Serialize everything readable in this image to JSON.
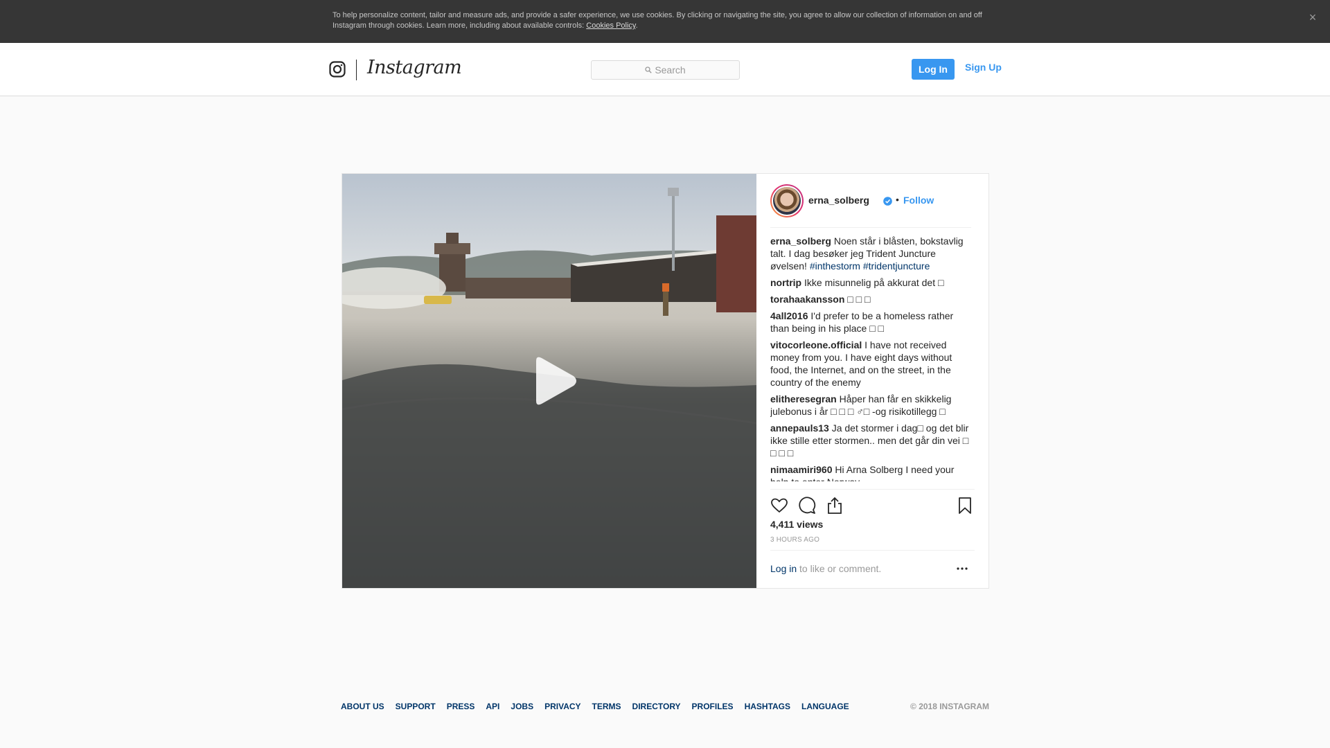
{
  "cookie_banner": {
    "text": "To help personalize content, tailor and measure ads, and provide a safer experience, we use cookies. By clicking or navigating the site, you agree to allow our collection of information on and off Instagram through cookies. Learn more, including about available controls: ",
    "link": "Cookies Policy",
    "trailing": ".",
    "close": "×"
  },
  "navbar": {
    "logo_text": "Instagram",
    "search_placeholder": "Search",
    "login_label": "Log In",
    "signup_label": "Sign Up"
  },
  "post": {
    "username": "erna_solberg",
    "separator": "•",
    "follow_label": "Follow",
    "caption": {
      "user": "erna_solberg",
      "text": " Noen står i blåsten, bokstavlig talt. I dag besøker jeg Trident Juncture øvelsen! ",
      "hashtags": [
        "#inthestorm",
        "#tridentjuncture"
      ]
    },
    "comments": [
      {
        "user": "nortrip",
        "text": " Ikke misunnelig på akkurat det □"
      },
      {
        "user": "torahaakansson",
        "text": " □ □ □"
      },
      {
        "user": "4all2016",
        "text": " I'd prefer to be a homeless rather than being in his place □ □"
      },
      {
        "user": "vitocorleone.official",
        "text": " I have not received money from you. I have eight days without food, the Internet, and on the street, in the country of the enemy"
      },
      {
        "user": "elitheresegran",
        "text": " Håper han får en skikkelig julebonus i år □ □ □ ♂□  -og risikotillegg □"
      },
      {
        "user": "annepauls13",
        "text": " Ja det stormer i dag□ og det blir ikke stille etter stormen.. men det går din vei □ □ □ □"
      },
      {
        "user": "nimaamiri960",
        "text": " Hi Arna Solberg I need your help to enter Norway"
      }
    ],
    "views": "4,411 views",
    "timestamp": "3 HOURS AGO",
    "login_prompt_link": "Log in",
    "login_prompt_text": " to like or comment.",
    "icons": {
      "like": "heart-icon",
      "comment": "comment-icon",
      "share": "share-icon",
      "save": "bookmark-icon",
      "more": "more-icon",
      "play": "play-icon"
    }
  },
  "footer": {
    "links": [
      "About us",
      "Support",
      "Press",
      "API",
      "Jobs",
      "Privacy",
      "Terms",
      "Directory",
      "Profiles",
      "Hashtags",
      "Language"
    ],
    "copyright": "© 2018 INSTAGRAM"
  },
  "colors": {
    "accent": "#3897f0",
    "link_dark": "#003569",
    "banner_bg": "#363636"
  }
}
